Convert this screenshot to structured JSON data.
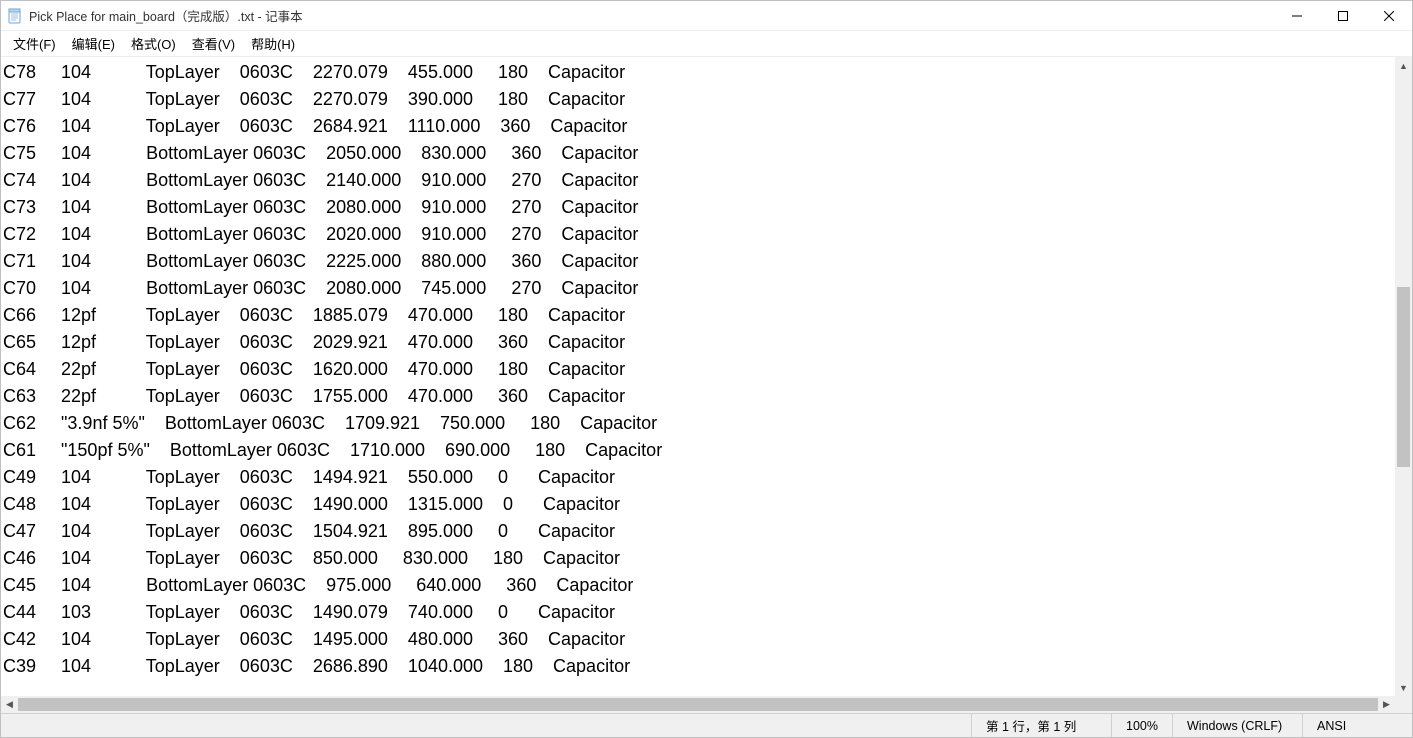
{
  "title": "Pick Place for main_board（完成版）.txt - 记事本",
  "menu": {
    "file": "文件(F)",
    "edit": "编辑(E)",
    "format": "格式(O)",
    "view": "查看(V)",
    "help": "帮助(H)"
  },
  "rows": [
    {
      "ref": "C78",
      "val": "104",
      "layer": "TopLayer",
      "fp": "0603C",
      "x": "2270.079",
      "y": "455.000",
      "rot": "180",
      "desc": "Capacitor"
    },
    {
      "ref": "C77",
      "val": "104",
      "layer": "TopLayer",
      "fp": "0603C",
      "x": "2270.079",
      "y": "390.000",
      "rot": "180",
      "desc": "Capacitor"
    },
    {
      "ref": "C76",
      "val": "104",
      "layer": "TopLayer",
      "fp": "0603C",
      "x": "2684.921",
      "y": "1110.000",
      "rot": "360",
      "desc": "Capacitor"
    },
    {
      "ref": "C75",
      "val": "104",
      "layer": "BottomLayer",
      "fp": "0603C",
      "x": "2050.000",
      "y": "830.000",
      "rot": "360",
      "desc": "Capacitor"
    },
    {
      "ref": "C74",
      "val": "104",
      "layer": "BottomLayer",
      "fp": "0603C",
      "x": "2140.000",
      "y": "910.000",
      "rot": "270",
      "desc": "Capacitor"
    },
    {
      "ref": "C73",
      "val": "104",
      "layer": "BottomLayer",
      "fp": "0603C",
      "x": "2080.000",
      "y": "910.000",
      "rot": "270",
      "desc": "Capacitor"
    },
    {
      "ref": "C72",
      "val": "104",
      "layer": "BottomLayer",
      "fp": "0603C",
      "x": "2020.000",
      "y": "910.000",
      "rot": "270",
      "desc": "Capacitor"
    },
    {
      "ref": "C71",
      "val": "104",
      "layer": "BottomLayer",
      "fp": "0603C",
      "x": "2225.000",
      "y": "880.000",
      "rot": "360",
      "desc": "Capacitor"
    },
    {
      "ref": "C70",
      "val": "104",
      "layer": "BottomLayer",
      "fp": "0603C",
      "x": "2080.000",
      "y": "745.000",
      "rot": "270",
      "desc": "Capacitor"
    },
    {
      "ref": "C66",
      "val": "12pf",
      "layer": "TopLayer",
      "fp": "0603C",
      "x": "1885.079",
      "y": "470.000",
      "rot": "180",
      "desc": "Capacitor"
    },
    {
      "ref": "C65",
      "val": "12pf",
      "layer": "TopLayer",
      "fp": "0603C",
      "x": "2029.921",
      "y": "470.000",
      "rot": "360",
      "desc": "Capacitor"
    },
    {
      "ref": "C64",
      "val": "22pf",
      "layer": "TopLayer",
      "fp": "0603C",
      "x": "1620.000",
      "y": "470.000",
      "rot": "180",
      "desc": "Capacitor"
    },
    {
      "ref": "C63",
      "val": "22pf",
      "layer": "TopLayer",
      "fp": "0603C",
      "x": "1755.000",
      "y": "470.000",
      "rot": "360",
      "desc": "Capacitor"
    },
    {
      "ref": "C62",
      "val": "\"3.9nf 5%\"",
      "layer": "BottomLayer",
      "fp": "0603C",
      "x": "1709.921",
      "y": "750.000",
      "rot": "180",
      "desc": "Capacitor"
    },
    {
      "ref": "C61",
      "val": "\"150pf 5%\"",
      "layer": "BottomLayer",
      "fp": "0603C",
      "x": "1710.000",
      "y": "690.000",
      "rot": "180",
      "desc": "Capacitor"
    },
    {
      "ref": "C49",
      "val": "104",
      "layer": "TopLayer",
      "fp": "0603C",
      "x": "1494.921",
      "y": "550.000",
      "rot": "0",
      "desc": "Capacitor"
    },
    {
      "ref": "C48",
      "val": "104",
      "layer": "TopLayer",
      "fp": "0603C",
      "x": "1490.000",
      "y": "1315.000",
      "rot": "0",
      "desc": "Capacitor"
    },
    {
      "ref": "C47",
      "val": "104",
      "layer": "TopLayer",
      "fp": "0603C",
      "x": "1504.921",
      "y": "895.000",
      "rot": "0",
      "desc": "Capacitor"
    },
    {
      "ref": "C46",
      "val": "104",
      "layer": "TopLayer",
      "fp": "0603C",
      "x": "850.000",
      "y": "830.000",
      "rot": "180",
      "desc": "Capacitor"
    },
    {
      "ref": "C45",
      "val": "104",
      "layer": "BottomLayer",
      "fp": "0603C",
      "x": "975.000",
      "y": "640.000",
      "rot": "360",
      "desc": "Capacitor"
    },
    {
      "ref": "C44",
      "val": "103",
      "layer": "TopLayer",
      "fp": "0603C",
      "x": "1490.079",
      "y": "740.000",
      "rot": "0",
      "desc": "Capacitor"
    },
    {
      "ref": "C42",
      "val": "104",
      "layer": "TopLayer",
      "fp": "0603C",
      "x": "1495.000",
      "y": "480.000",
      "rot": "360",
      "desc": "Capacitor"
    },
    {
      "ref": "C39",
      "val": "104",
      "layer": "TopLayer",
      "fp": "0603C",
      "x": "2686.890",
      "y": "1040.000",
      "rot": "180",
      "desc": "Capacitor"
    }
  ],
  "status": {
    "position": "第 1 行，第 1 列",
    "zoom": "100%",
    "crlf": "Windows (CRLF)",
    "encoding": "ANSI"
  }
}
